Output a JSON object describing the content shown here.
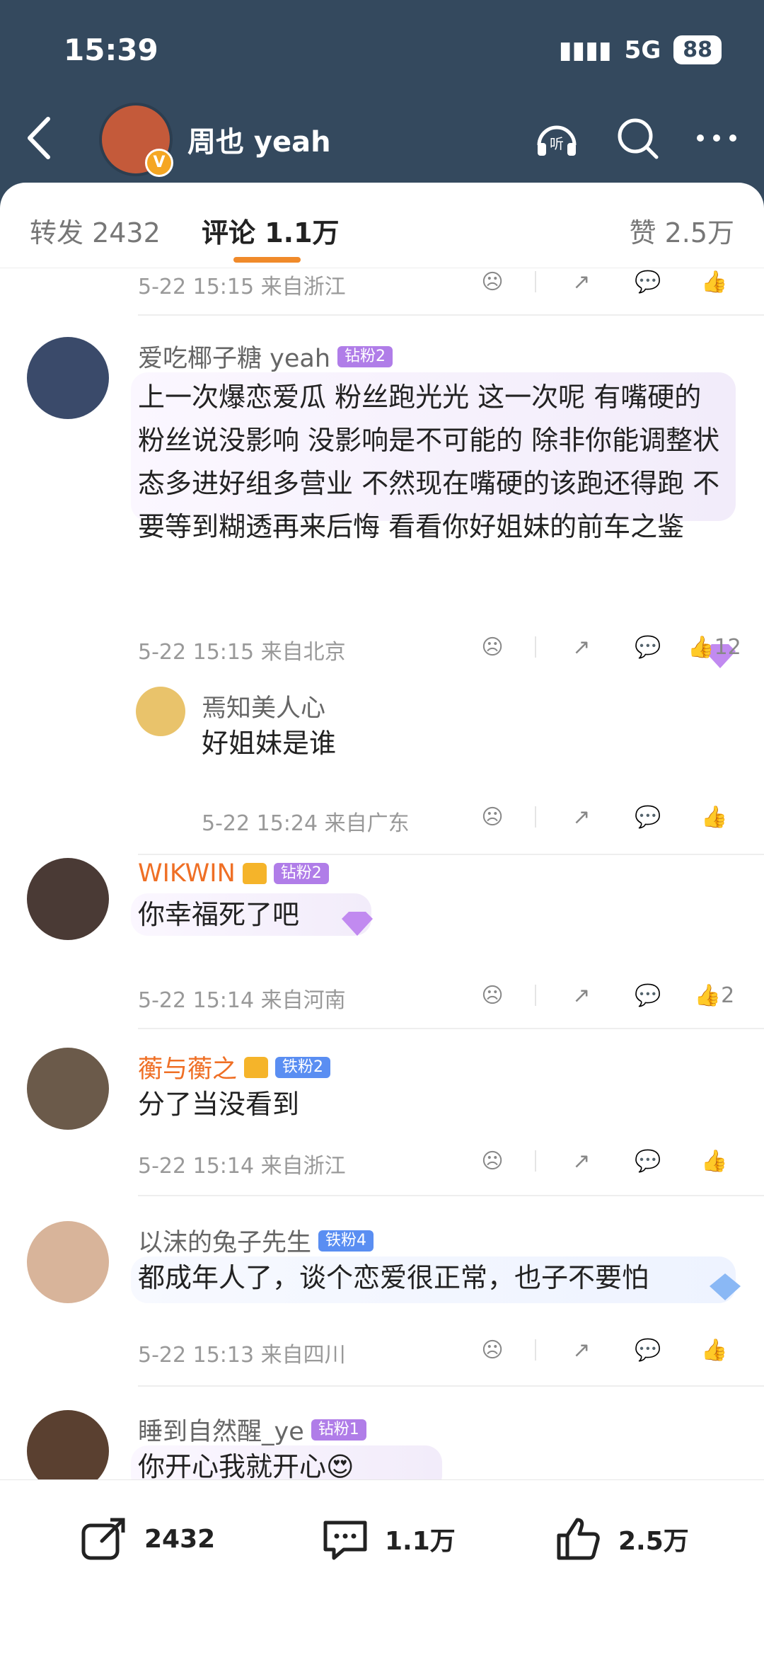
{
  "status_bar": {
    "time": "15:39",
    "network": "5G",
    "battery": "88"
  },
  "header": {
    "user_name": "周也 yeah",
    "verified_mark": "V"
  },
  "tabs": {
    "repost": "转发 2432",
    "comments": "评论 1.1万",
    "likes": "赞 2.5万"
  },
  "comments": [
    {
      "meta": "5-22 15:15 来自浙江"
    },
    {
      "name": "爱吃椰子糖 yeah",
      "badge": "钻粉2",
      "text": "上一次爆恋爱瓜 粉丝跑光光 这一次呢 有嘴硬的粉丝说没影响 没影响是不可能的 除非你能调整状态多进好组多营业 不然现在嘴硬的该跑还得跑  不要等到糊透再来后悔 看看你好姐妹的前车之鉴",
      "meta": "5-22 15:15 来自北京",
      "likes": "12"
    },
    {
      "name": "焉知美人心",
      "text": "好姐妹是谁",
      "meta": "5-22 15:24 来自广东"
    },
    {
      "name": "WIKWIN",
      "badge": "钻粉2",
      "text": "你幸福死了吧",
      "meta": "5-22 15:14 来自河南",
      "likes": "2"
    },
    {
      "name": "蘅与蘅之",
      "badge": "铁粉2",
      "text": "分了当没看到",
      "meta": "5-22 15:14 来自浙江"
    },
    {
      "name": "以沫的兔子先生",
      "badge": "铁粉4",
      "text": "都成年人了，谈个恋爱很正常，也子不要怕",
      "meta": "5-22 15:13 来自四川"
    },
    {
      "name": "睡到自然醒_ye",
      "badge": "钻粉1",
      "text": "你开心我就开心😍"
    }
  ],
  "bottom_bar": {
    "repost": "2432",
    "comment": "1.1万",
    "like": "2.5万"
  },
  "colors": {
    "header": "#34495e",
    "accent": "#f08a2a",
    "name_orange": "#ef6f25"
  }
}
